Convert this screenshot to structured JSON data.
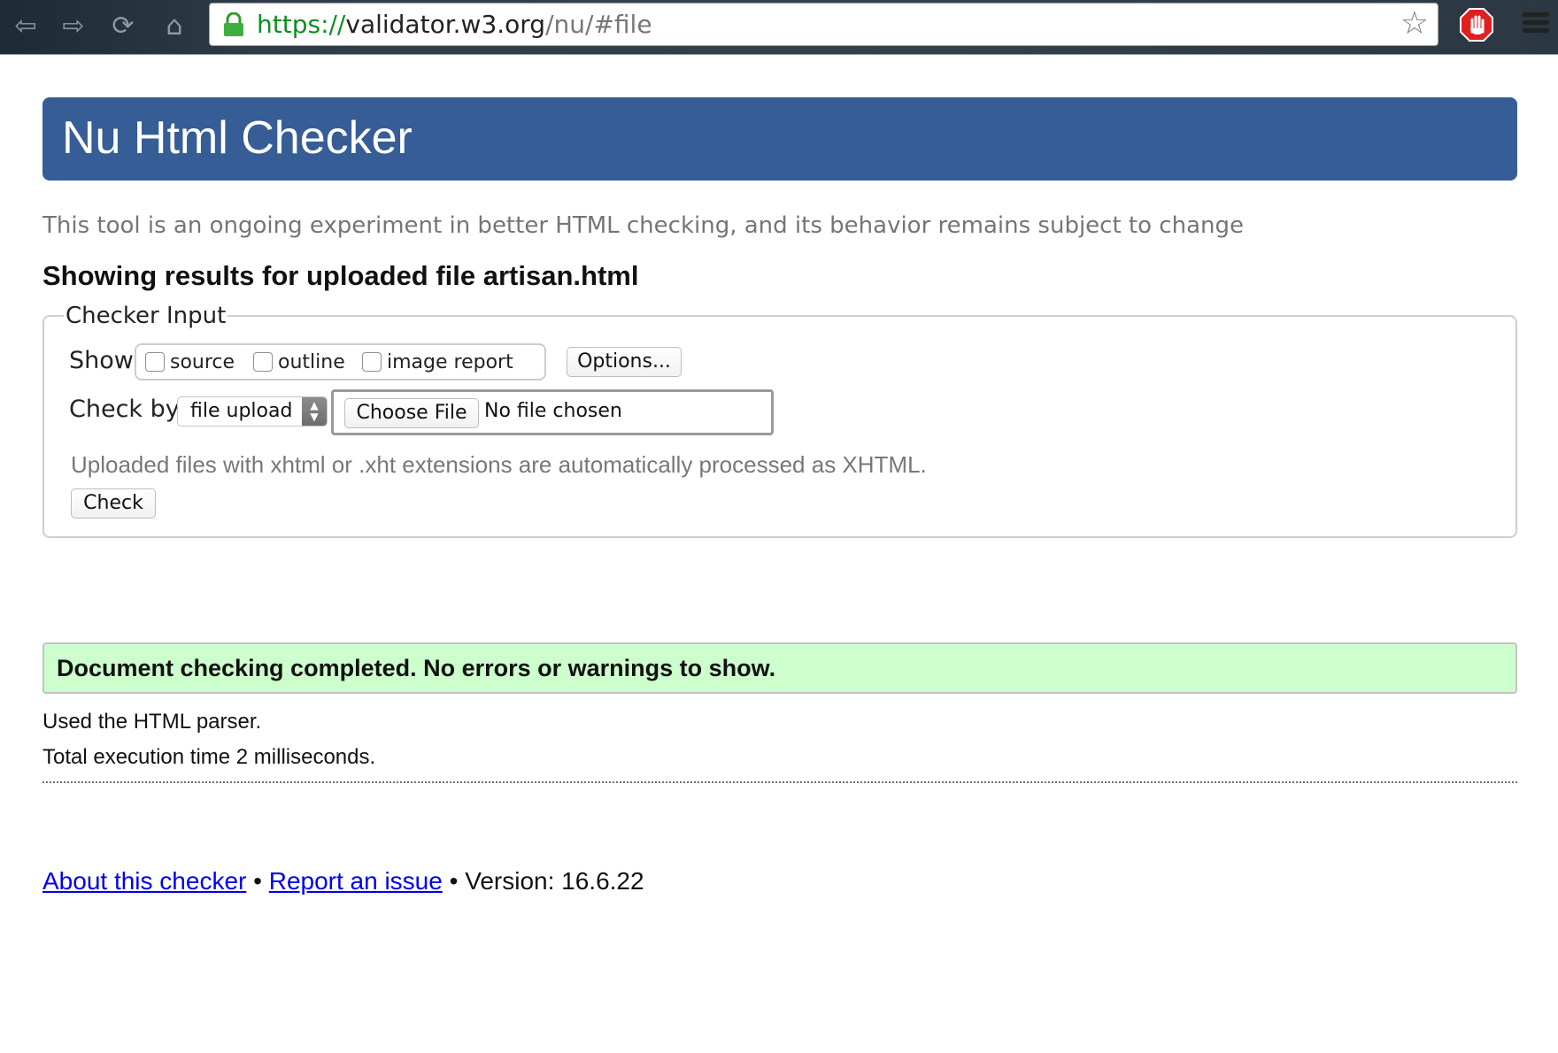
{
  "browser": {
    "url": {
      "scheme": "https://",
      "host": "validator.w3.org",
      "path": "/nu/#file"
    },
    "icons": {
      "back": "back-arrow-icon",
      "forward": "forward-arrow-icon",
      "reload": "reload-icon",
      "home": "home-icon",
      "lock": "lock-icon",
      "bookmark": "star-icon",
      "extension": "adblock-hand-icon",
      "menu": "hamburger-menu-icon"
    },
    "colors": {
      "secure_scheme": "#0b8f1f",
      "extension_red": "#e02020"
    }
  },
  "header": {
    "title": "Nu Html Checker",
    "background": "#365d96"
  },
  "intro": "This tool is an ongoing experiment in better HTML checking, and its behavior remains subject to change",
  "results_heading": "Showing results for uploaded file artisan.html",
  "checker_input": {
    "legend": "Checker Input",
    "show_label": "Show",
    "show_options": [
      {
        "label": "source",
        "checked": false
      },
      {
        "label": "outline",
        "checked": false
      },
      {
        "label": "image report",
        "checked": false
      }
    ],
    "options_button": "Options...",
    "check_by_label": "Check by",
    "check_by_selected": "file upload",
    "choose_file_button": "Choose File",
    "file_status": "No file chosen",
    "hint": "Uploaded files with xhtml or .xht extensions are automatically processed as XHTML.",
    "check_button": "Check"
  },
  "result": {
    "message": "Document checking completed. No errors or warnings to show.",
    "background": "#ccffcc",
    "parser": "Used the HTML parser.",
    "timing": "Total execution time 2 milliseconds."
  },
  "footer": {
    "about_link": "About this checker",
    "separator": "•",
    "report_link": "Report an issue",
    "version": "Version: 16.6.22"
  }
}
